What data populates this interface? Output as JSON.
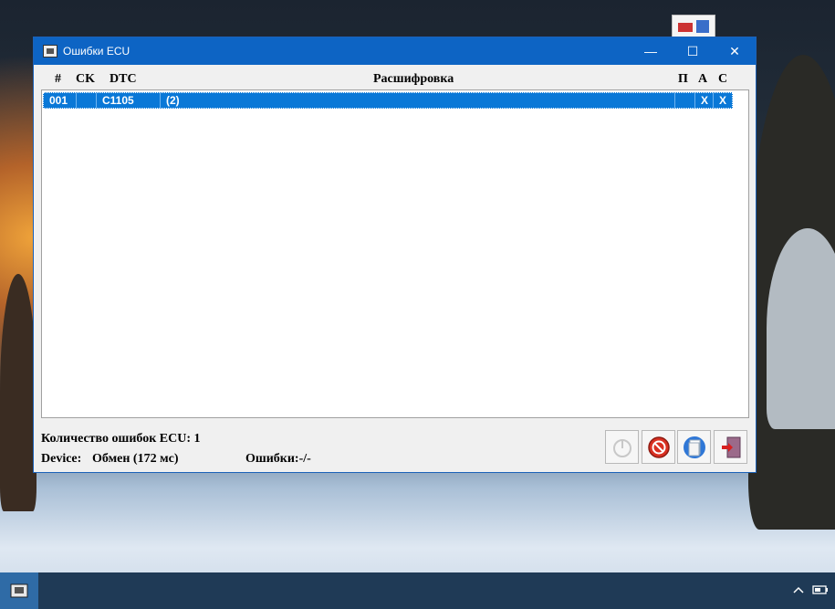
{
  "window": {
    "title": "Ошибки ECU",
    "controls": {
      "minimize": "—",
      "maximize": "☐",
      "close": "✕"
    }
  },
  "table": {
    "columns": [
      "#",
      "CK",
      "DTC",
      "Расшифровка",
      "П",
      "А",
      "С"
    ],
    "rows": [
      {
        "num": "001",
        "ck": "",
        "dtc": "C1105",
        "desc": "(2)",
        "p": "",
        "a": "X",
        "c": "X"
      }
    ]
  },
  "status": {
    "count_label": "Количество ошибок ECU: 1",
    "device_label": "Device:",
    "device_value": "Обмен (172 мс)",
    "errors_label": "Ошибки:-/-"
  },
  "toolbar": {
    "icons": [
      "info-icon",
      "clear-errors-icon",
      "save-report-icon",
      "exit-icon"
    ]
  },
  "colors": {
    "titlebar": "#0d64c4",
    "selection": "#0a78d7",
    "window_bg": "#f0f0f0",
    "taskbar": "#1f3a56"
  }
}
